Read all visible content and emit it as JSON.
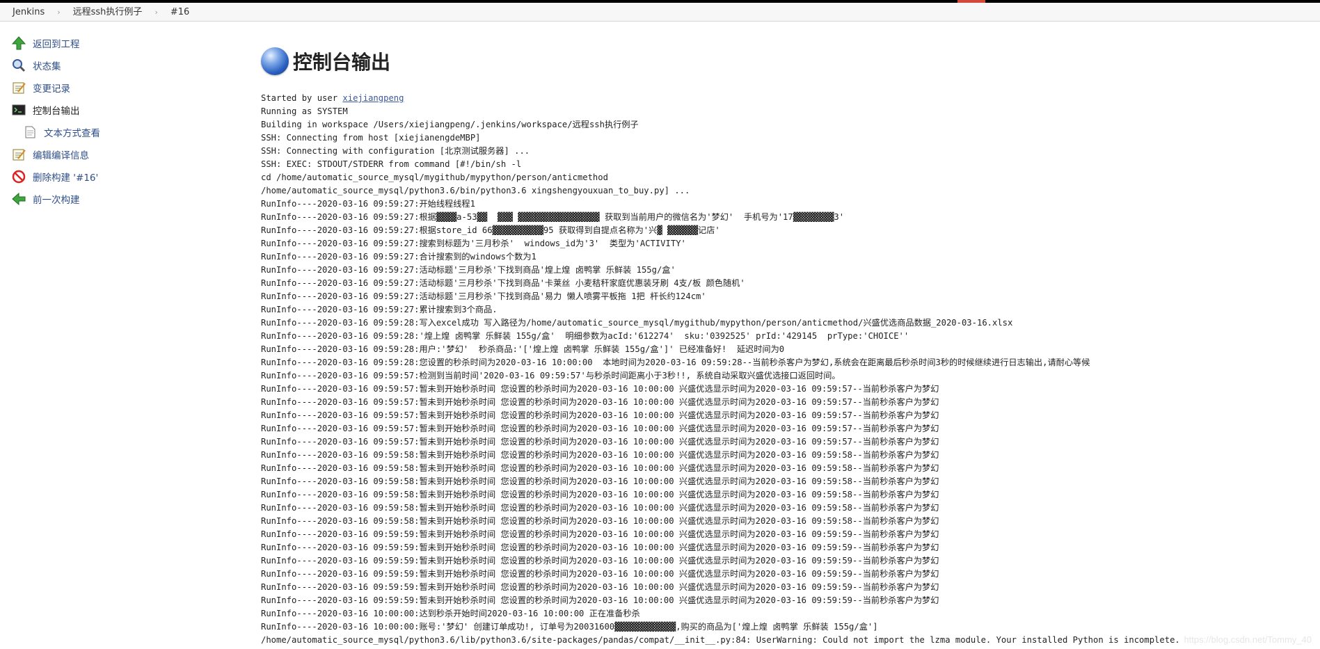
{
  "breadcrumb": [
    {
      "label": "Jenkins"
    },
    {
      "label": "远程ssh执行例子"
    },
    {
      "label": "#16"
    }
  ],
  "sidebar": {
    "items": [
      {
        "label": "返回到工程",
        "icon": "up-arrow-icon"
      },
      {
        "label": "状态集",
        "icon": "magnifier-icon"
      },
      {
        "label": "变更记录",
        "icon": "notepad-icon"
      },
      {
        "label": "控制台输出",
        "icon": "terminal-icon"
      },
      {
        "label": "文本方式查看",
        "icon": "document-icon"
      },
      {
        "label": "编辑编译信息",
        "icon": "notepad-icon"
      },
      {
        "label": "删除构建 '#16'",
        "icon": "no-entry-icon"
      },
      {
        "label": "前一次构建",
        "icon": "left-arrow-icon"
      }
    ]
  },
  "main": {
    "title": "控制台输出"
  },
  "console": {
    "started_prefix": "Started by user ",
    "started_user": "xiejiangpeng",
    "lines": [
      "Running as SYSTEM",
      "Building in workspace /Users/xiejiangpeng/.jenkins/workspace/远程ssh执行例子",
      "SSH: Connecting from host [xiejianengdeMBP]",
      "SSH: Connecting with configuration [北京测试服务器] ...",
      "SSH: EXEC: STDOUT/STDERR from command [#!/bin/sh -l",
      "cd /home/automatic_source_mysql/mygithub/mypython/person/anticmethod",
      "/home/automatic_source_mysql/python3.6/bin/python3.6 xingshengyouxuan_to_buy.py] ...",
      "RunInfo----2020-03-16 09:59:27:开始线程线程1",
      "RunInfo----2020-03-16 09:59:27:根据▓▓▓▓a-53▓▓  ▓▓▓ ▓▓▓▓▓▓▓▓▓▓▓▓▓▓▓▓ 获取到当前用户的微信名为'梦幻'  手机号为'17▓▓▓▓▓▓▓▓3'",
      "RunInfo----2020-03-16 09:59:27:根据store_id 66▓▓▓▓▓▓▓▓▓▓95 获取得到自提点名称为'兴▓ ▓▓▓▓▓▓记店'",
      "RunInfo----2020-03-16 09:59:27:搜索到标题为'三月秒杀'  windows_id为'3'  类型为'ACTIVITY'",
      "RunInfo----2020-03-16 09:59:27:合计搜索到的windows个数为1",
      "RunInfo----2020-03-16 09:59:27:活动标题'三月秒杀'下找到商品'煌上煌 卤鸭掌 乐鲜装 155g/盒'",
      "RunInfo----2020-03-16 09:59:27:活动标题'三月秒杀'下找到商品'卡莱丝 小麦秸秆家庭优惠装牙刷 4支/板 颜色随机'",
      "RunInfo----2020-03-16 09:59:27:活动标题'三月秒杀'下找到商品'易力 懒人喷雾平板拖 1把 杆长约124cm'",
      "RunInfo----2020-03-16 09:59:27:累计搜索到3个商品.",
      "RunInfo----2020-03-16 09:59:28:写入excel成功 写入路径为/home/automatic_source_mysql/mygithub/mypython/person/anticmethod/兴盛优选商品数据_2020-03-16.xlsx",
      "RunInfo----2020-03-16 09:59:28:'煌上煌 卤鸭掌 乐鲜装 155g/盒'  明细参数为acId:'612274'  sku:'0392525' prId:'429145  prType:'CHOICE''",
      "RunInfo----2020-03-16 09:59:28:用户:'梦幻'  秒杀商品:'['煌上煌 卤鸭掌 乐鲜装 155g/盒']' 已经准备好!  延迟时间为0",
      "RunInfo----2020-03-16 09:59:28:您设置的秒杀时间为2020-03-16 10:00:00  本地时间为2020-03-16 09:59:28--当前秒杀客户为梦幻,系统会在距离最后秒杀时间3秒的时候继续进行日志输出,请耐心等候",
      "RunInfo----2020-03-16 09:59:57:检测到当前时间'2020-03-16 09:59:57'与秒杀时间距离小于3秒!!, 系统自动采取兴盛优选接口返回时间。",
      "RunInfo----2020-03-16 09:59:57:暂未到开始秒杀时间 您设置的秒杀时间为2020-03-16 10:00:00 兴盛优选显示时间为2020-03-16 09:59:57--当前秒杀客户为梦幻",
      "RunInfo----2020-03-16 09:59:57:暂未到开始秒杀时间 您设置的秒杀时间为2020-03-16 10:00:00 兴盛优选显示时间为2020-03-16 09:59:57--当前秒杀客户为梦幻",
      "RunInfo----2020-03-16 09:59:57:暂未到开始秒杀时间 您设置的秒杀时间为2020-03-16 10:00:00 兴盛优选显示时间为2020-03-16 09:59:57--当前秒杀客户为梦幻",
      "RunInfo----2020-03-16 09:59:57:暂未到开始秒杀时间 您设置的秒杀时间为2020-03-16 10:00:00 兴盛优选显示时间为2020-03-16 09:59:57--当前秒杀客户为梦幻",
      "RunInfo----2020-03-16 09:59:57:暂未到开始秒杀时间 您设置的秒杀时间为2020-03-16 10:00:00 兴盛优选显示时间为2020-03-16 09:59:57--当前秒杀客户为梦幻",
      "RunInfo----2020-03-16 09:59:58:暂未到开始秒杀时间 您设置的秒杀时间为2020-03-16 10:00:00 兴盛优选显示时间为2020-03-16 09:59:58--当前秒杀客户为梦幻",
      "RunInfo----2020-03-16 09:59:58:暂未到开始秒杀时间 您设置的秒杀时间为2020-03-16 10:00:00 兴盛优选显示时间为2020-03-16 09:59:58--当前秒杀客户为梦幻",
      "RunInfo----2020-03-16 09:59:58:暂未到开始秒杀时间 您设置的秒杀时间为2020-03-16 10:00:00 兴盛优选显示时间为2020-03-16 09:59:58--当前秒杀客户为梦幻",
      "RunInfo----2020-03-16 09:59:58:暂未到开始秒杀时间 您设置的秒杀时间为2020-03-16 10:00:00 兴盛优选显示时间为2020-03-16 09:59:58--当前秒杀客户为梦幻",
      "RunInfo----2020-03-16 09:59:58:暂未到开始秒杀时间 您设置的秒杀时间为2020-03-16 10:00:00 兴盛优选显示时间为2020-03-16 09:59:58--当前秒杀客户为梦幻",
      "RunInfo----2020-03-16 09:59:58:暂未到开始秒杀时间 您设置的秒杀时间为2020-03-16 10:00:00 兴盛优选显示时间为2020-03-16 09:59:58--当前秒杀客户为梦幻",
      "RunInfo----2020-03-16 09:59:59:暂未到开始秒杀时间 您设置的秒杀时间为2020-03-16 10:00:00 兴盛优选显示时间为2020-03-16 09:59:59--当前秒杀客户为梦幻",
      "RunInfo----2020-03-16 09:59:59:暂未到开始秒杀时间 您设置的秒杀时间为2020-03-16 10:00:00 兴盛优选显示时间为2020-03-16 09:59:59--当前秒杀客户为梦幻",
      "RunInfo----2020-03-16 09:59:59:暂未到开始秒杀时间 您设置的秒杀时间为2020-03-16 10:00:00 兴盛优选显示时间为2020-03-16 09:59:59--当前秒杀客户为梦幻",
      "RunInfo----2020-03-16 09:59:59:暂未到开始秒杀时间 您设置的秒杀时间为2020-03-16 10:00:00 兴盛优选显示时间为2020-03-16 09:59:59--当前秒杀客户为梦幻",
      "RunInfo----2020-03-16 09:59:59:暂未到开始秒杀时间 您设置的秒杀时间为2020-03-16 10:00:00 兴盛优选显示时间为2020-03-16 09:59:59--当前秒杀客户为梦幻",
      "RunInfo----2020-03-16 09:59:59:暂未到开始秒杀时间 您设置的秒杀时间为2020-03-16 10:00:00 兴盛优选显示时间为2020-03-16 09:59:59--当前秒杀客户为梦幻",
      "RunInfo----2020-03-16 10:00:00:达到秒杀开始时间2020-03-16 10:00:00 正在准备秒杀",
      "RunInfo----2020-03-16 10:00:00:账号:'梦幻' 创建订单成功!, 订单号为20031600▓▓▓▓▓▓▓▓▓▓▓▓,购买的商品为['煌上煌 卤鸭掌 乐鲜装 155g/盒']",
      "/home/automatic_source_mysql/python3.6/lib/python3.6/site-packages/pandas/compat/__init__.py:84: UserWarning: Could not import the lzma module. Your installed Python is incomplete."
    ]
  },
  "watermark": "https://blog.csdn.net/Tommy_40"
}
